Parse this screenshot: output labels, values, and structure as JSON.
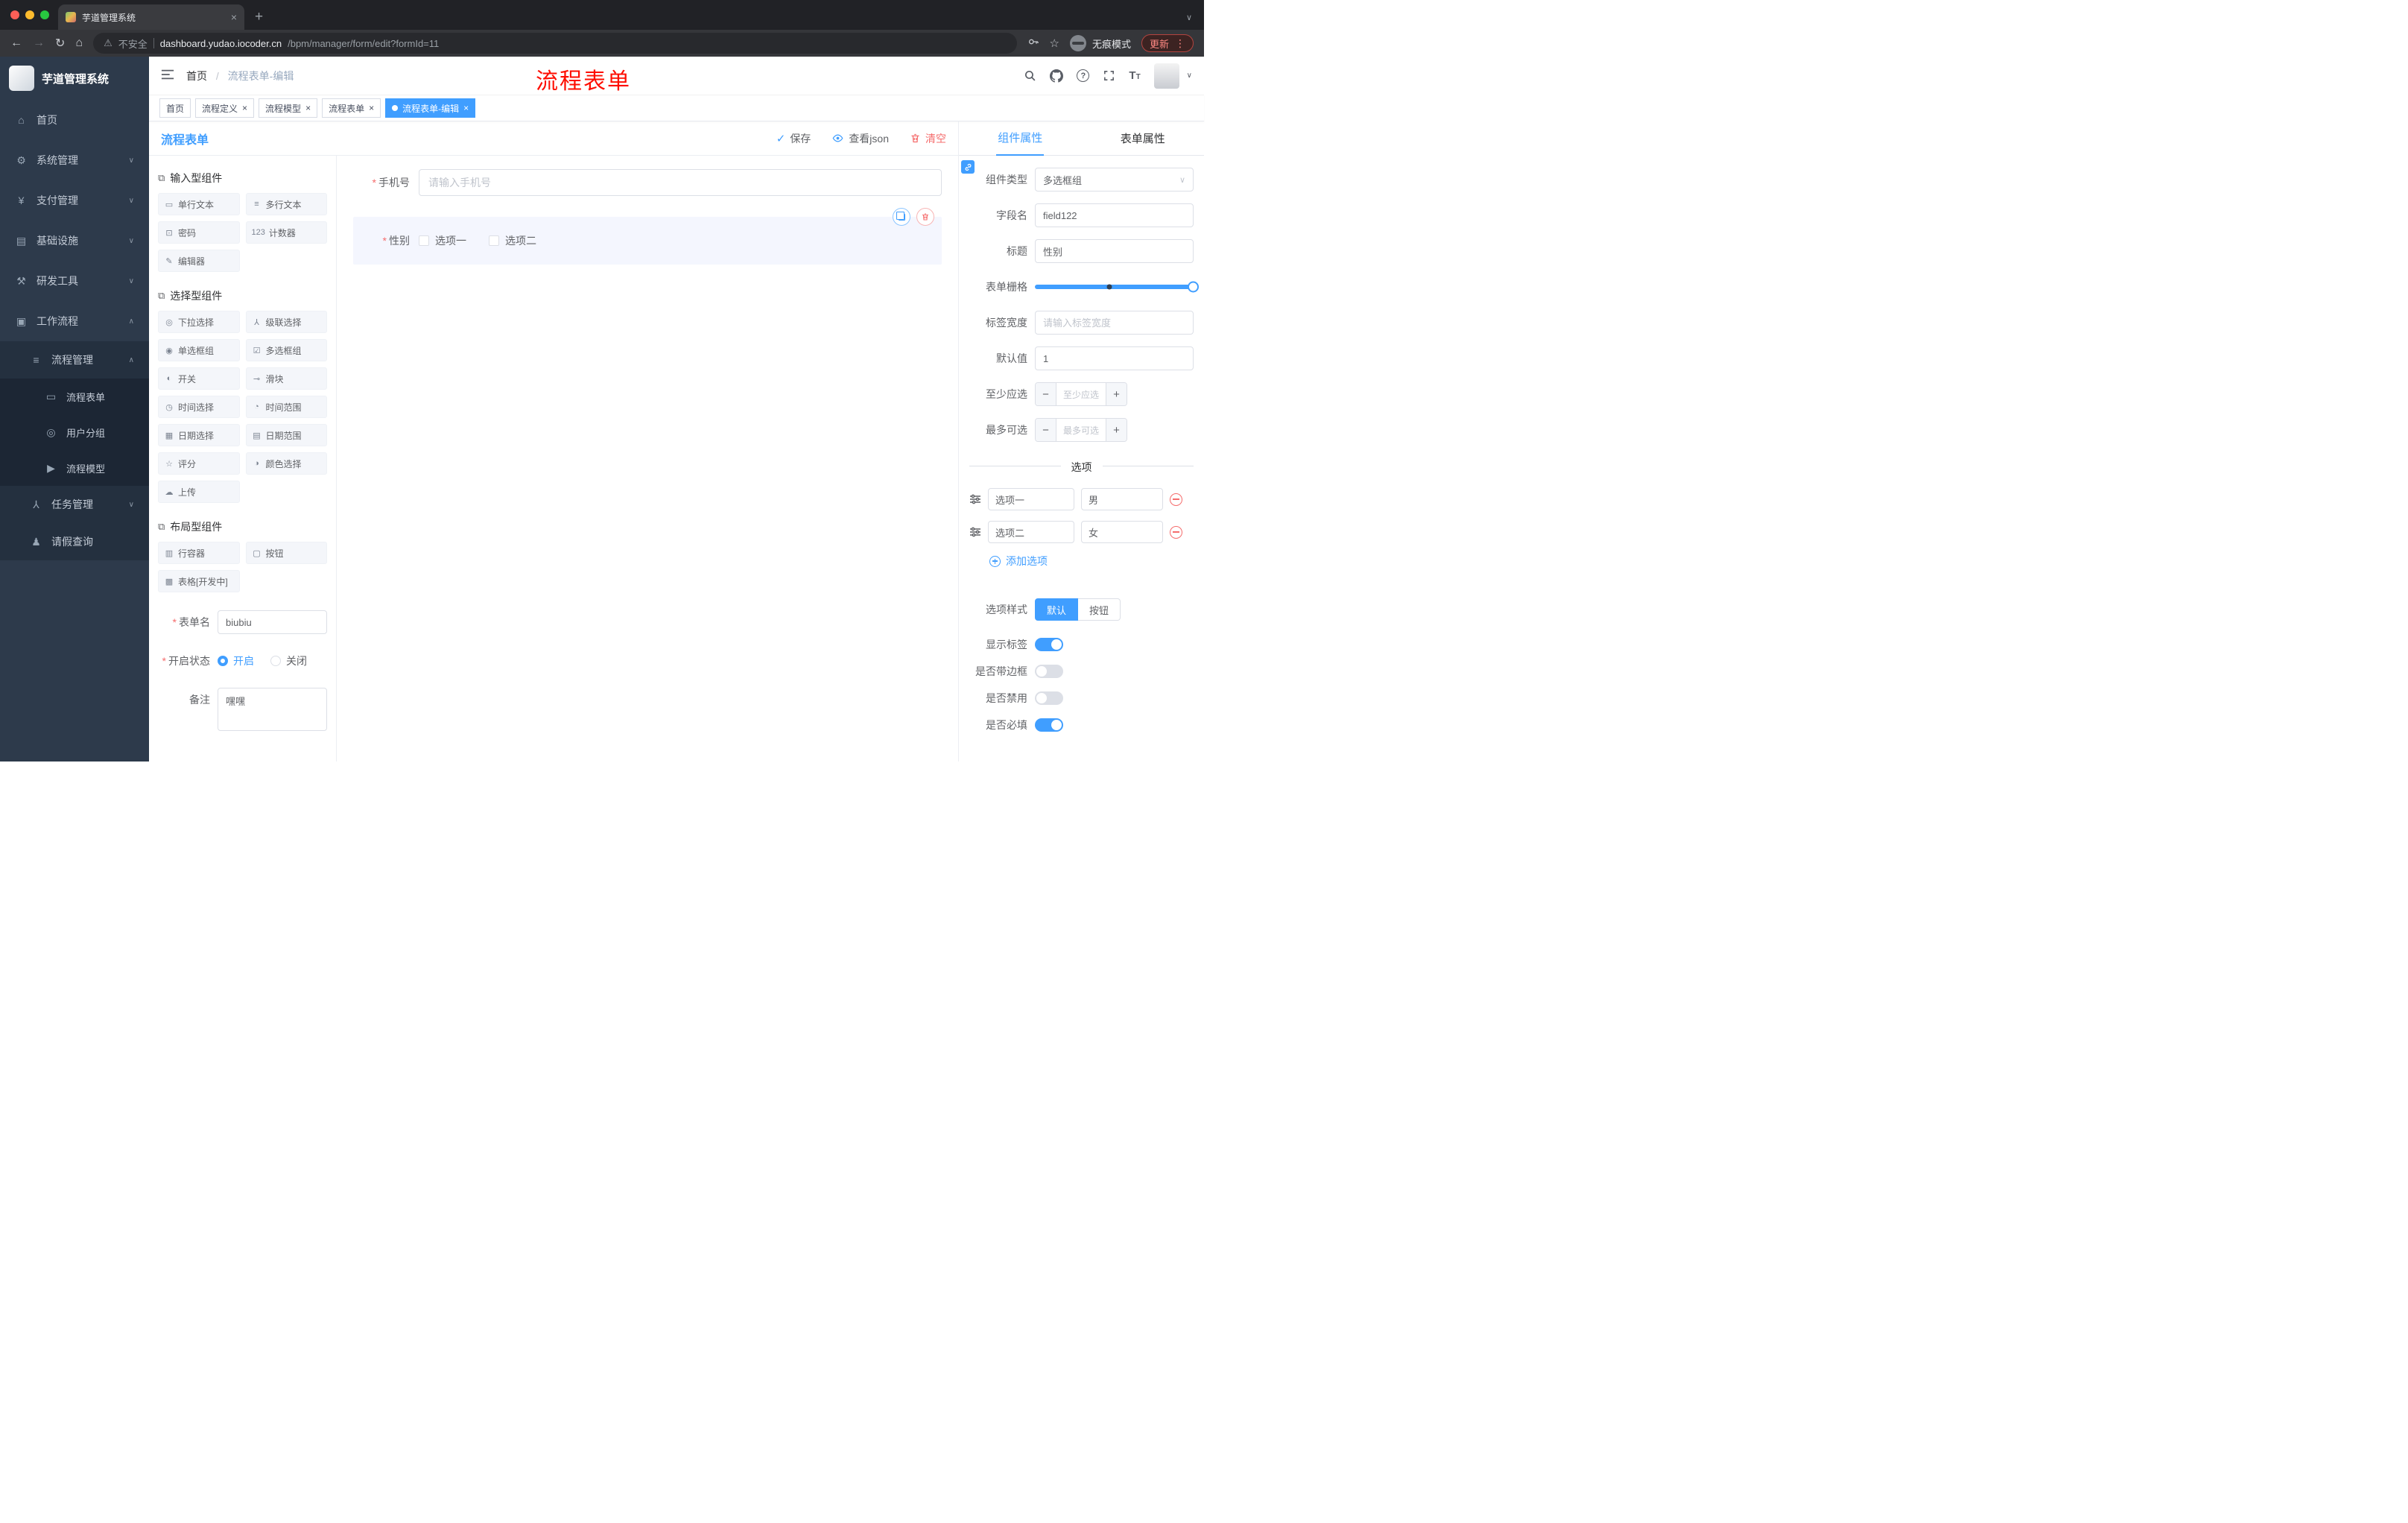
{
  "browser": {
    "tab_title": "芋道管理系统",
    "security_label": "不安全",
    "url_domain": "dashboard.yudao.iocoder.cn",
    "url_path": "/bpm/manager/form/edit?formId=11",
    "incognito_label": "无痕模式",
    "update_label": "更新"
  },
  "sidebar": {
    "brand": "芋道管理系统",
    "top_items": [
      {
        "icon": "⌂",
        "label": "首页"
      },
      {
        "icon": "⚙",
        "label": "系统管理"
      },
      {
        "icon": "¥",
        "label": "支付管理"
      },
      {
        "icon": "▤",
        "label": "基础设施"
      },
      {
        "icon": "⚒",
        "label": "研发工具"
      },
      {
        "icon": "▣",
        "label": "工作流程"
      }
    ],
    "workflow": {
      "process_mgmt": {
        "icon": "≡",
        "label": "流程管理"
      },
      "process_children": [
        {
          "icon": "▭",
          "label": "流程表单"
        },
        {
          "icon": "◎",
          "label": "用户分组"
        },
        {
          "icon": "▶",
          "label": "流程模型"
        }
      ],
      "task_mgmt": {
        "icon": "⅄",
        "label": "任务管理"
      },
      "leave": {
        "icon": "♟",
        "label": "请假查询"
      }
    }
  },
  "header": {
    "breadcrumb_home": "首页",
    "breadcrumb_current": "流程表单-编辑",
    "annotation": "流程表单"
  },
  "tags": [
    {
      "label": "首页"
    },
    {
      "label": "流程定义"
    },
    {
      "label": "流程模型"
    },
    {
      "label": "流程表单"
    },
    {
      "label": "流程表单-编辑"
    }
  ],
  "builder": {
    "title": "流程表单",
    "save": "保存",
    "view_json": "查看json",
    "clear": "清空",
    "groups": [
      {
        "icon": "⧉",
        "title": "输入型组件",
        "items": [
          {
            "icon": "▭",
            "label": "单行文本"
          },
          {
            "icon": "≡",
            "label": "多行文本"
          },
          {
            "icon": "⊡",
            "label": "密码"
          },
          {
            "icon": "123",
            "label": "计数器"
          },
          {
            "icon": "✎",
            "label": "编辑器"
          }
        ]
      },
      {
        "icon": "⧉",
        "title": "选择型组件",
        "items": [
          {
            "icon": "◎",
            "label": "下拉选择"
          },
          {
            "icon": "⅄",
            "label": "级联选择"
          },
          {
            "icon": "◉",
            "label": "单选框组"
          },
          {
            "icon": "☑",
            "label": "多选框组"
          },
          {
            "icon": "◐",
            "label": "开关"
          },
          {
            "icon": "⊸",
            "label": "滑块"
          },
          {
            "icon": "◷",
            "label": "时间选择"
          },
          {
            "icon": "◔",
            "label": "时间范围"
          },
          {
            "icon": "▦",
            "label": "日期选择"
          },
          {
            "icon": "▤",
            "label": "日期范围"
          },
          {
            "icon": "☆",
            "label": "评分"
          },
          {
            "icon": "◑",
            "label": "颜色选择"
          },
          {
            "icon": "☁",
            "label": "上传"
          }
        ]
      },
      {
        "icon": "⧉",
        "title": "布局型组件",
        "items": [
          {
            "icon": "▥",
            "label": "行容器"
          },
          {
            "icon": "▢",
            "label": "按钮"
          },
          {
            "icon": "▩",
            "label": "表格[开发中]"
          }
        ]
      }
    ],
    "meta": {
      "form_name_label": "表单名",
      "form_name_value": "biubiu",
      "status_label": "开启状态",
      "status_on": "开启",
      "status_off": "关闭",
      "remark_label": "备注",
      "remark_value": "嘿嘿"
    }
  },
  "canvas": {
    "phone_label": "手机号",
    "phone_placeholder": "请输入手机号",
    "gender_label": "性别",
    "gender_opt1": "选项一",
    "gender_opt2": "选项二"
  },
  "props": {
    "tab_component": "组件属性",
    "tab_form": "表单属性",
    "type_label": "组件类型",
    "type_value": "多选框组",
    "field_label": "字段名",
    "field_value": "field122",
    "title_label": "标题",
    "title_value": "性别",
    "grid_label": "表单栅格",
    "label_width_label": "标签宽度",
    "label_width_placeholder": "请输入标签宽度",
    "default_label": "默认值",
    "default_value": "1",
    "min_label": "至少应选",
    "min_placeholder": "至少应选",
    "max_label": "最多可选",
    "max_placeholder": "最多可选",
    "options_title": "选项",
    "options": [
      {
        "label": "选项一",
        "value": "男"
      },
      {
        "label": "选项二",
        "value": "女"
      }
    ],
    "add_option": "添加选项",
    "style_label": "选项样式",
    "style_default": "默认",
    "style_button": "按钮",
    "toggles": [
      {
        "label": "显示标签",
        "on": true
      },
      {
        "label": "是否带边框",
        "on": false
      },
      {
        "label": "是否禁用",
        "on": false
      },
      {
        "label": "是否必填",
        "on": true
      }
    ]
  },
  "colors": {
    "accent": "#409eff",
    "danger": "#f56c6c",
    "annotation": "#fe0d00"
  }
}
